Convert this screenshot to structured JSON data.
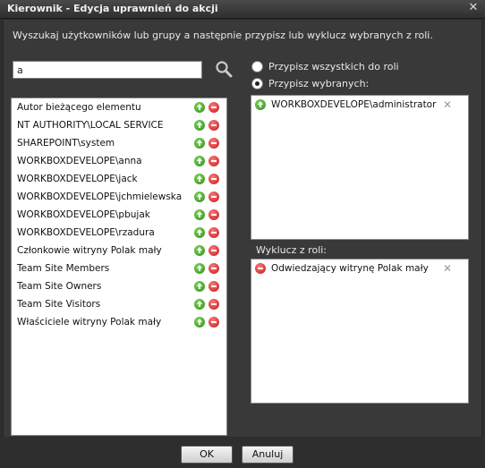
{
  "dialog": {
    "title": "Kierownik  - Edycja uprawnień do akcji",
    "instructions": "Wyszukaj użytkowników lub grupy a następnie przypisz lub wyklucz wybranych z roli."
  },
  "search": {
    "value": "a"
  },
  "results": [
    "Autor bieżącego elementu",
    "NT AUTHORITY\\LOCAL SERVICE",
    "SHAREPOINT\\system",
    "WORKBOXDEVELOPE\\anna",
    "WORKBOXDEVELOPE\\jack",
    "WORKBOXDEVELOPE\\jchmielewska",
    "WORKBOXDEVELOPE\\pbujak",
    "WORKBOXDEVELOPE\\rzadura",
    "Członkowie witryny Polak mały",
    "Team Site Members",
    "Team Site Owners",
    "Team Site Visitors",
    "Właściciele witryny Polak mały"
  ],
  "assign": {
    "all_label": "Przypisz wszystkich do roli",
    "selected_label": "Przypisz wybranych:",
    "mode": "selected",
    "entries": [
      "WORKBOXDEVELOPE\\administrator"
    ]
  },
  "exclude": {
    "label": "Wyklucz z roli:",
    "entries": [
      "Odwiedzający witrynę Polak mały"
    ]
  },
  "buttons": {
    "ok": "OK",
    "cancel": "Anuluj"
  },
  "colors": {
    "title_bar": "#3a3a3a",
    "panel": "#393939",
    "add": "#3c9a22",
    "remove": "#d02020"
  }
}
